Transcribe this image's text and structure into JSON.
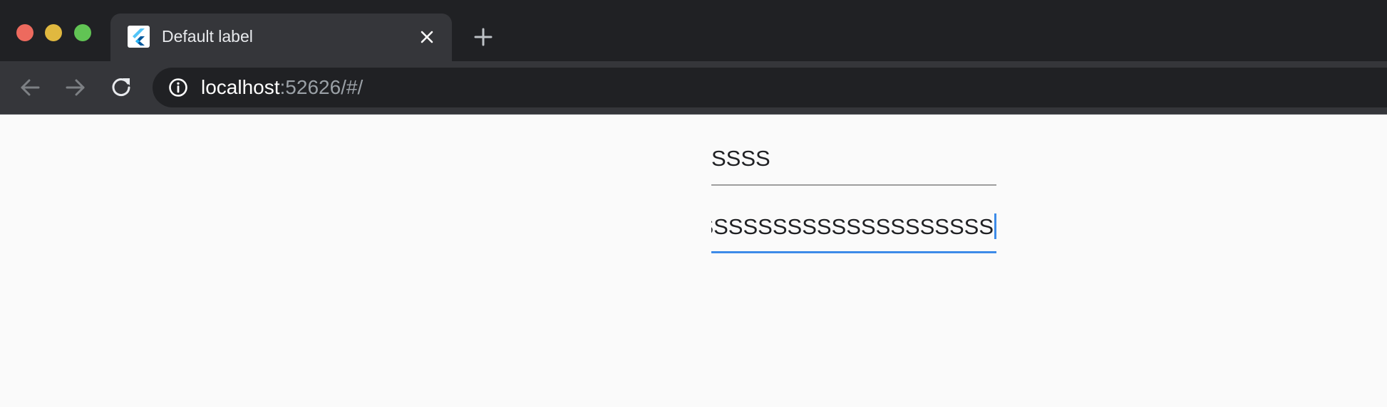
{
  "browser": {
    "tab": {
      "title": "Default label",
      "favicon": "flutter-logo-icon",
      "close_icon": "close-icon"
    },
    "new_tab_icon": "plus-icon",
    "nav": {
      "back_icon": "arrow-left-icon",
      "forward_icon": "arrow-right-icon",
      "reload_icon": "reload-icon"
    },
    "address_bar": {
      "info_icon": "info-icon",
      "host": "localhost",
      "rest": ":52626/#/"
    }
  },
  "page": {
    "field_1": {
      "value": "SSSS"
    },
    "field_2": {
      "value": "SSSSSSSSSSSSSSSSSSSSSSSS",
      "focused": true
    }
  },
  "colors": {
    "titlebar": "#202124",
    "toolbar": "#35363a",
    "page_background": "#fafafa",
    "focus_accent": "#3d8be8",
    "underline_inactive": "#9e9e9e"
  }
}
